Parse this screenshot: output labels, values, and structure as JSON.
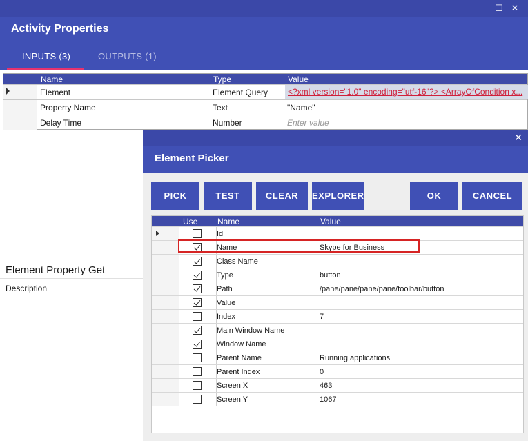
{
  "activity": {
    "title": "Activity Properties",
    "tabs": [
      {
        "label": "INPUTS (3)",
        "active": true
      },
      {
        "label": "OUTPUTS (1)",
        "active": false
      }
    ],
    "columns": [
      "Name",
      "Type",
      "Value"
    ],
    "rows": [
      {
        "name": "Element",
        "type": "Element Query",
        "value": "<?xml version=\"1.0\" encoding=\"utf-16\"?> <ArrayOfCondition x..."
      },
      {
        "name": "Property Name",
        "type": "Text",
        "value": "\"Name\""
      },
      {
        "name": "Delay Time",
        "type": "Number",
        "placeholder": "Enter value"
      }
    ],
    "activity_name": "Element Property Get",
    "description_label": "Description"
  },
  "picker": {
    "title": "Element Picker",
    "buttons": {
      "pick": "PICK",
      "test": "TEST",
      "clear": "CLEAR",
      "explorer": "EXPLORER",
      "ok": "OK",
      "cancel": "CANCEL"
    },
    "columns": [
      "Use",
      "Name",
      "Value"
    ],
    "rows": [
      {
        "name": "Id",
        "value": "",
        "checked": false
      },
      {
        "name": "Name",
        "value": "Skype for Business",
        "checked": true
      },
      {
        "name": "Class Name",
        "value": "",
        "checked": true
      },
      {
        "name": "Type",
        "value": "button",
        "checked": true
      },
      {
        "name": "Path",
        "value": "/pane/pane/pane/pane/toolbar/button",
        "checked": true
      },
      {
        "name": "Value",
        "value": "",
        "checked": true
      },
      {
        "name": "Index",
        "value": "7",
        "checked": false
      },
      {
        "name": "Main Window Name",
        "value": "",
        "checked": true
      },
      {
        "name": "Window Name",
        "value": "",
        "checked": true
      },
      {
        "name": "Parent Name",
        "value": "Running applications",
        "checked": false
      },
      {
        "name": "Parent Index",
        "value": "0",
        "checked": false
      },
      {
        "name": "Screen X",
        "value": "463",
        "checked": false
      },
      {
        "name": "Screen Y",
        "value": "1067",
        "checked": false
      }
    ]
  },
  "colors": {
    "header": "#4050b5",
    "accent": "#e8336e",
    "link": "#d0203a",
    "highlight_border": "#d62424"
  }
}
